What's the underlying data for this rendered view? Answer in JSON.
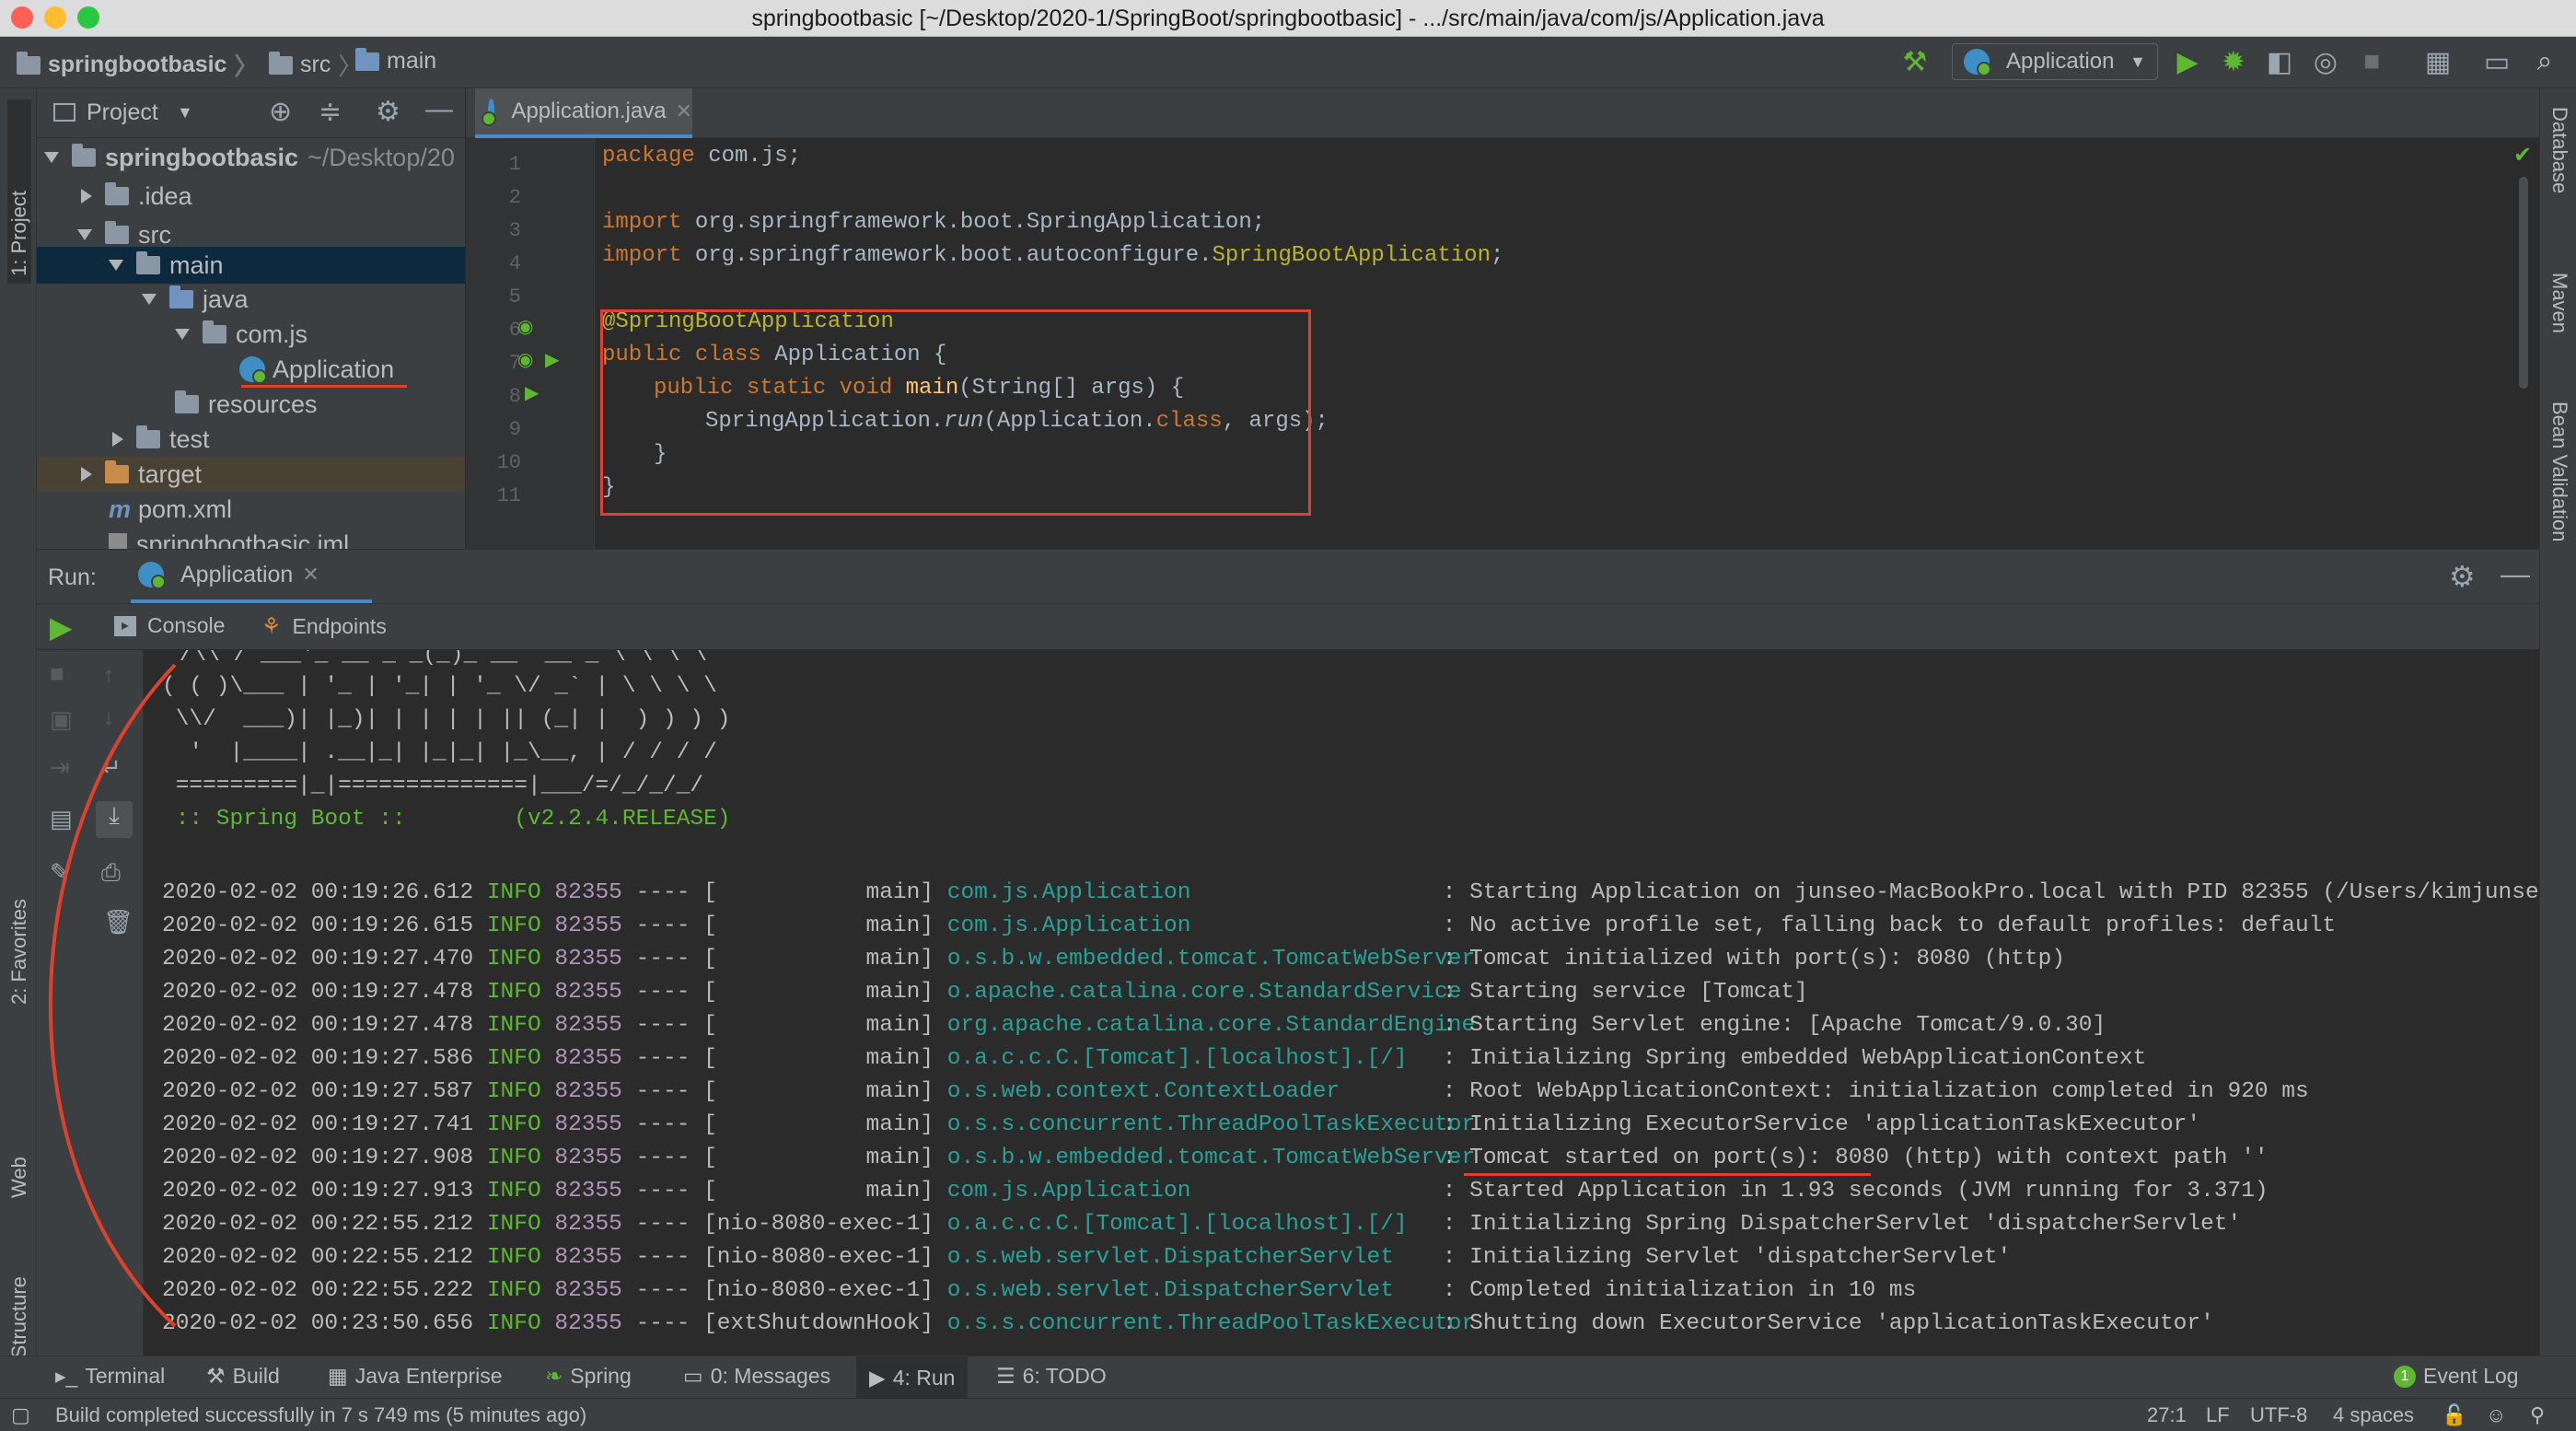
{
  "window": {
    "title": "springbootbasic [~/Desktop/2020-1/SpringBoot/springbootbasic] - .../src/main/java/com/js/Application.java"
  },
  "breadcrumbs": [
    "springbootbasic",
    "src",
    "main"
  ],
  "toolbar": {
    "run_config": "Application"
  },
  "left_tabs": {
    "project": "1: Project",
    "favorites": "2: Favorites",
    "web": "Web",
    "structure": "Z: Structure"
  },
  "right_tabs": {
    "database": "Database",
    "maven": "Maven",
    "bean_validation": "Bean Validation"
  },
  "project_panel": {
    "title": "Project",
    "tree": [
      {
        "label": "springbootbasic",
        "suffix": "~/Desktop/20"
      },
      {
        "label": ".idea"
      },
      {
        "label": "src"
      },
      {
        "label": "main"
      },
      {
        "label": "java"
      },
      {
        "label": "com.js"
      },
      {
        "label": "Application"
      },
      {
        "label": "resources"
      },
      {
        "label": "test"
      },
      {
        "label": "target"
      },
      {
        "label": "pom.xml"
      },
      {
        "label": "springbootbasic.iml"
      }
    ]
  },
  "editor": {
    "tab": "Application.java",
    "line_numbers": [
      "1",
      "2",
      "3",
      "4",
      "5",
      "6",
      "7",
      "8",
      "9",
      "10",
      "11"
    ],
    "code": {
      "l1_kw": "package",
      "l1_rest": " com.js;",
      "l3_kw": "import",
      "l3_rest": " org.springframework.boot.SpringApplication;",
      "l4_kw": "import",
      "l4_rest": " org.springframework.boot.autoconfigure.",
      "l4_ann": "SpringBootApplication",
      "l4_end": ";",
      "l6": "@SpringBootApplication",
      "l7_kw": "public class",
      "l7_rest": " Application {",
      "l8_kw": "public static void",
      "l8_fn": " main",
      "l8_rest": "(String[] args) {",
      "l9_a": "SpringApplication.",
      "l9_run": "run",
      "l9_b": "(Application.",
      "l9_kw": "class",
      "l9_c": ", args);",
      "l10": "}",
      "l11": "}"
    }
  },
  "run_panel": {
    "label": "Run:",
    "tab": "Application",
    "subtabs": {
      "console": "Console",
      "endpoints": "Endpoints"
    },
    "banner": [
      " /\\\\ / ___'_ __ _ _(_)_ __  __ _ \\ \\ \\ \\",
      "( ( )\\___ | '_ | '_| | '_ \\/ _` | \\ \\ \\ \\",
      " \\\\/  ___)| |_)| | | | | || (_| |  ) ) ) )",
      "  '  |____| .__|_| |_|_| |_\\__, | / / / /",
      " =========|_|==============|___/=/_/_/_/"
    ],
    "spring_boot": " :: Spring Boot ::        (v2.2.4.RELEASE)",
    "logs": [
      {
        "ts": "2020-02-02 00:19:26.612",
        "level": "INFO",
        "pid": "82355",
        "thread": "---- [           main]",
        "cls": "com.js.Application",
        "msg": ": Starting Application on junseo-MacBookPro.local with PID 82355 (/Users/kimjunseo/Des"
      },
      {
        "ts": "2020-02-02 00:19:26.615",
        "level": "INFO",
        "pid": "82355",
        "thread": "---- [           main]",
        "cls": "com.js.Application",
        "msg": ": No active profile set, falling back to default profiles: default"
      },
      {
        "ts": "2020-02-02 00:19:27.470",
        "level": "INFO",
        "pid": "82355",
        "thread": "---- [           main]",
        "cls": "o.s.b.w.embedded.tomcat.TomcatWebServer",
        "msg": ": Tomcat initialized with port(s): 8080 (http)"
      },
      {
        "ts": "2020-02-02 00:19:27.478",
        "level": "INFO",
        "pid": "82355",
        "thread": "---- [           main]",
        "cls": "o.apache.catalina.core.StandardService",
        "msg": ": Starting service [Tomcat]"
      },
      {
        "ts": "2020-02-02 00:19:27.478",
        "level": "INFO",
        "pid": "82355",
        "thread": "---- [           main]",
        "cls": "org.apache.catalina.core.StandardEngine",
        "msg": ": Starting Servlet engine: [Apache Tomcat/9.0.30]"
      },
      {
        "ts": "2020-02-02 00:19:27.586",
        "level": "INFO",
        "pid": "82355",
        "thread": "---- [           main]",
        "cls": "o.a.c.c.C.[Tomcat].[localhost].[/]",
        "msg": ": Initializing Spring embedded WebApplicationContext"
      },
      {
        "ts": "2020-02-02 00:19:27.587",
        "level": "INFO",
        "pid": "82355",
        "thread": "---- [           main]",
        "cls": "o.s.web.context.ContextLoader",
        "msg": ": Root WebApplicationContext: initialization completed in 920 ms"
      },
      {
        "ts": "2020-02-02 00:19:27.741",
        "level": "INFO",
        "pid": "82355",
        "thread": "---- [           main]",
        "cls": "o.s.s.concurrent.ThreadPoolTaskExecutor",
        "msg": ": Initializing ExecutorService 'applicationTaskExecutor'"
      },
      {
        "ts": "2020-02-02 00:19:27.908",
        "level": "INFO",
        "pid": "82355",
        "thread": "---- [           main]",
        "cls": "o.s.b.w.embedded.tomcat.TomcatWebServer",
        "msg": ": Tomcat started on port(s): 8080 (http) with context path ''"
      },
      {
        "ts": "2020-02-02 00:19:27.913",
        "level": "INFO",
        "pid": "82355",
        "thread": "---- [           main]",
        "cls": "com.js.Application",
        "msg": ": Started Application in 1.93 seconds (JVM running for 3.371)"
      },
      {
        "ts": "2020-02-02 00:22:55.212",
        "level": "INFO",
        "pid": "82355",
        "thread": "---- [nio-8080-exec-1]",
        "cls": "o.a.c.c.C.[Tomcat].[localhost].[/]",
        "msg": ": Initializing Spring DispatcherServlet 'dispatcherServlet'"
      },
      {
        "ts": "2020-02-02 00:22:55.212",
        "level": "INFO",
        "pid": "82355",
        "thread": "---- [nio-8080-exec-1]",
        "cls": "o.s.web.servlet.DispatcherServlet",
        "msg": ": Initializing Servlet 'dispatcherServlet'"
      },
      {
        "ts": "2020-02-02 00:22:55.222",
        "level": "INFO",
        "pid": "82355",
        "thread": "---- [nio-8080-exec-1]",
        "cls": "o.s.web.servlet.DispatcherServlet",
        "msg": ": Completed initialization in 10 ms"
      },
      {
        "ts": "2020-02-02 00:23:50.656",
        "level": "INFO",
        "pid": "82355",
        "thread": "---- [extShutdownHook]",
        "cls": "o.s.s.concurrent.ThreadPoolTaskExecutor",
        "msg": ": Shutting down ExecutorService 'applicationTaskExecutor'"
      }
    ]
  },
  "bottom_tabs": {
    "terminal": "Terminal",
    "build": "Build",
    "java_enterprise": "Java Enterprise",
    "spring": "Spring",
    "messages": "0: Messages",
    "run": "4: Run",
    "todo": "6: TODO",
    "event_log": "Event Log",
    "event_count": "1"
  },
  "status": {
    "message": "Build completed successfully in 7 s 749 ms (5 minutes ago)",
    "position": "27:1",
    "line_sep": "LF",
    "encoding": "UTF-8",
    "indent": "4 spaces"
  },
  "colors": {
    "accent": "#4a88c7",
    "run_green": "#5fb832",
    "annotation_red": "#e0412d"
  }
}
